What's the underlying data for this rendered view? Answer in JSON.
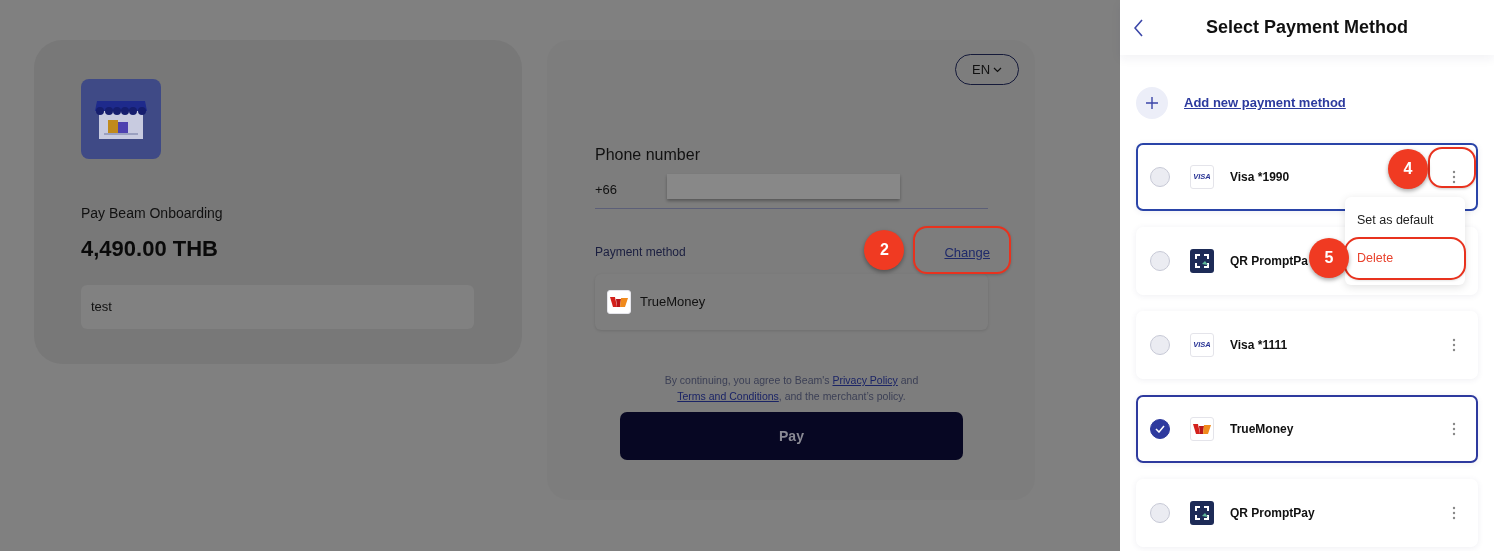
{
  "merchant": {
    "name": "Pay Beam Onboarding",
    "amount": "4,490.00 THB",
    "note": "test"
  },
  "checkout": {
    "language": "EN",
    "phone_label": "Phone number",
    "country_code": "+66",
    "payment_label": "Payment method",
    "change_link": "Change",
    "change_annotation": "2",
    "selected_method": {
      "name": "TrueMoney",
      "kind": "truemoney"
    },
    "consent": [
      {
        "kind": "text",
        "text": "By continuing, you agree to Beam's"
      },
      {
        "kind": "link",
        "text": "Privacy Policy"
      },
      {
        "kind": "text",
        "text": "and"
      },
      {
        "kind": "link",
        "text": "Terms and Conditions"
      },
      {
        "kind": "text",
        "text": ", and the merchant’s policy."
      }
    ],
    "pay_button": "Pay"
  },
  "panel": {
    "title": "Select Payment Method",
    "add_label": "Add new payment method",
    "methods": [
      {
        "name": "Visa *1990",
        "kind": "visa",
        "logo": "VISA",
        "selected": false,
        "menu_open": true,
        "menu_annotation": "4"
      },
      {
        "name": "QR PromptPa",
        "kind": "promptpay",
        "selected": false,
        "menu_open": false
      },
      {
        "name": "Visa *1111",
        "kind": "visa",
        "logo": "VISA",
        "selected": false,
        "menu_open": false
      },
      {
        "name": "TrueMoney",
        "kind": "truemoney",
        "selected": true,
        "menu_open": false
      },
      {
        "name": "QR PromptPay",
        "kind": "promptpay",
        "selected": false,
        "menu_open": false
      }
    ],
    "menu": [
      {
        "label": "Set as default",
        "kind": "normal"
      },
      {
        "label": "Delete",
        "kind": "danger",
        "annotation": "5"
      }
    ]
  }
}
